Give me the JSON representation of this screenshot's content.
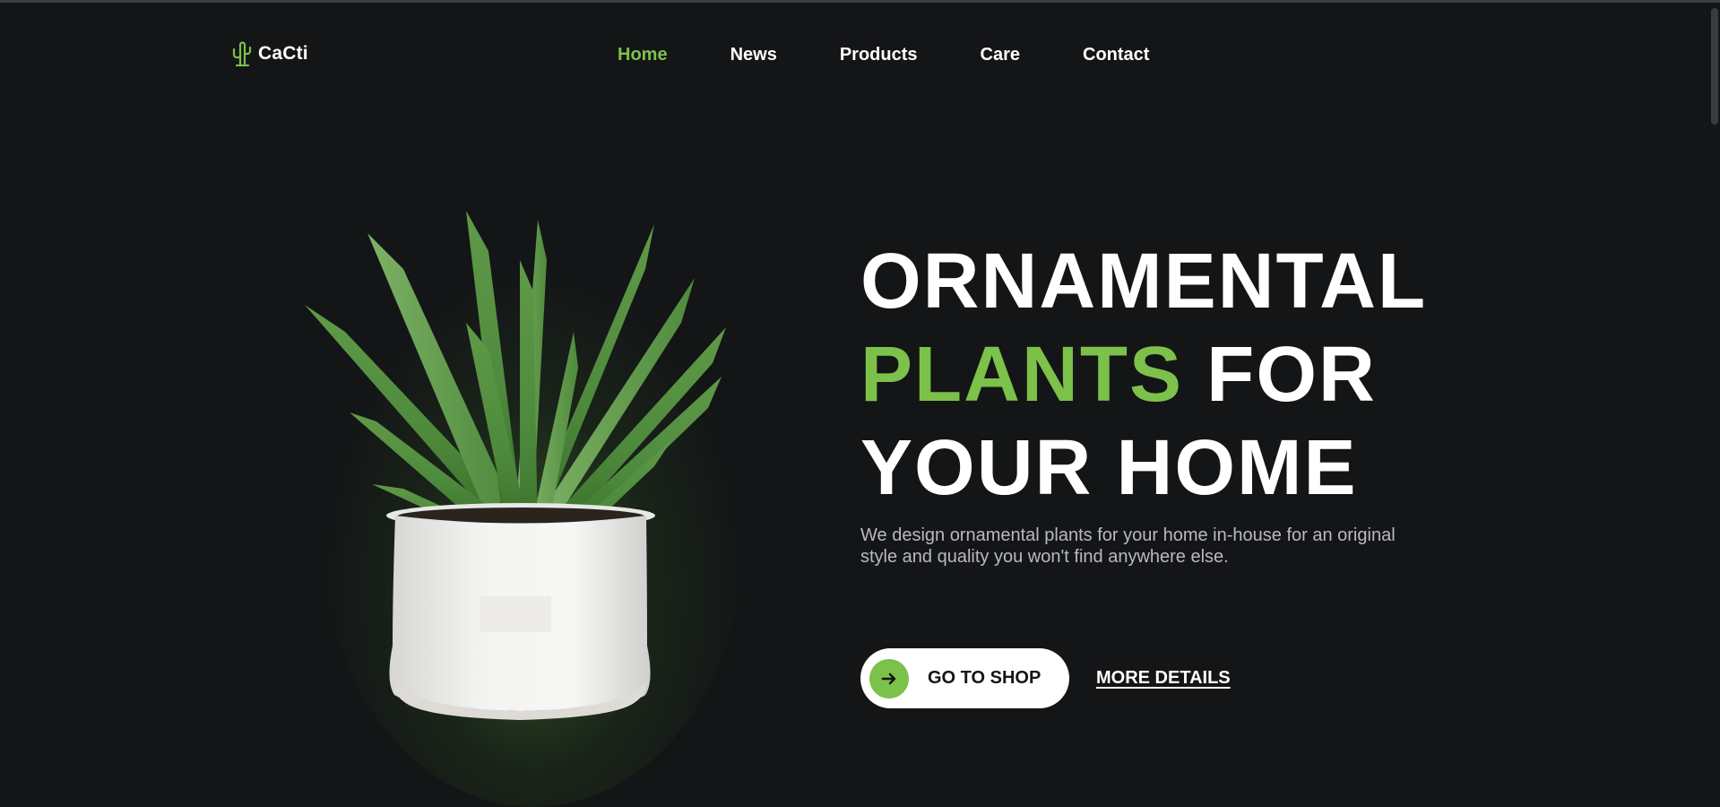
{
  "brand": {
    "name": "CaCti",
    "logo_icon": "cactus-icon",
    "accent_color": "#7cc14a",
    "background_color": "#141517"
  },
  "nav": {
    "items": [
      {
        "label": "Home",
        "active": true
      },
      {
        "label": "News",
        "active": false
      },
      {
        "label": "Products",
        "active": false
      },
      {
        "label": "Care",
        "active": false
      },
      {
        "label": "Contact",
        "active": false
      }
    ]
  },
  "hero": {
    "headline_line1": "ORNAMENTAL",
    "headline_line2_highlight": "PLANTS",
    "headline_line2_rest": " FOR",
    "headline_line3": "YOUR HOME",
    "description": "We design ornamental plants for your home in-house for an original style and quality you won't find anywhere else.",
    "primary_button": {
      "label": "GO TO SHOP",
      "icon": "arrow-right-icon"
    },
    "secondary_link": {
      "label": "MORE DETAILS"
    },
    "image": "potted-aloe-plant-image"
  }
}
